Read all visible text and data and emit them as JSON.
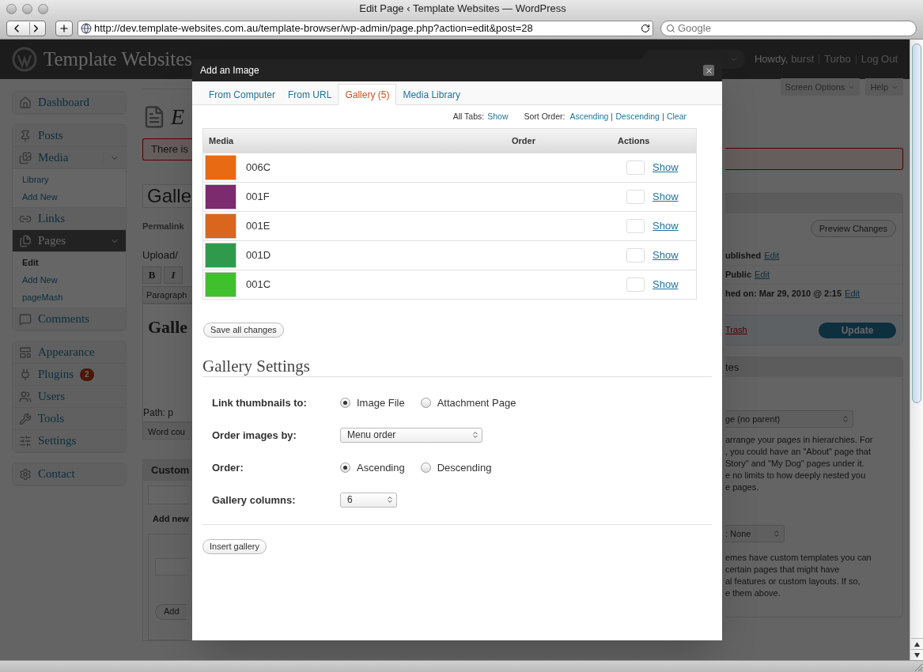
{
  "browser": {
    "title": "Edit Page ‹ Template Websites — WordPress",
    "url": "http://dev.template-websites.com.au/template-browser/wp-admin/page.php?action=edit&post=28",
    "search": {
      "placeholder": "Google"
    }
  },
  "wp_header": {
    "site_title": "Template Websites",
    "greeting": "Howdy,",
    "user": "burst",
    "links": [
      "Turbo",
      "Log Out"
    ]
  },
  "screen_meta": [
    "Screen Options",
    "Help"
  ],
  "sidebar": {
    "groups": [
      [
        {
          "label": "Dashboard",
          "selected": false
        }
      ],
      [
        {
          "label": "Posts",
          "selected": false
        },
        {
          "label": "Media",
          "selected": false,
          "expanded": true,
          "children": [
            {
              "label": "Library",
              "selected": false
            },
            {
              "label": "Add New",
              "selected": false
            }
          ]
        },
        {
          "label": "Links",
          "selected": false
        },
        {
          "label": "Pages",
          "selected": true,
          "expanded": true,
          "children": [
            {
              "label": "Edit",
              "selected": true
            },
            {
              "label": "Add New",
              "selected": false
            },
            {
              "label": "pageMash",
              "selected": false
            }
          ]
        },
        {
          "label": "Comments",
          "selected": false
        }
      ],
      [
        {
          "label": "Appearance",
          "selected": false
        },
        {
          "label": "Plugins",
          "selected": false,
          "badge": "2"
        },
        {
          "label": "Users",
          "selected": false
        },
        {
          "label": "Tools",
          "selected": false
        },
        {
          "label": "Settings",
          "selected": false
        }
      ],
      [
        {
          "label": "Contact",
          "selected": false
        }
      ]
    ]
  },
  "editor_strip": {
    "heading": "E",
    "notice": "There is",
    "title_value": "Galle",
    "permalink": "Permalink",
    "upload_label": "Upload/",
    "toolbar": [
      "B",
      "I"
    ],
    "format_select": "Paragraph",
    "content": "Galle",
    "path": "Path: p",
    "word_count": "Word cou",
    "custom_box": "Custom",
    "add_new": "Add new",
    "add_button": "Add"
  },
  "publish_box": {
    "preview_button": "Preview Changes",
    "rows": [
      {
        "label": "ublished",
        "link": "Edit"
      },
      {
        "label": "Public",
        "link": "Edit"
      },
      {
        "label": "hed on: Mar 29, 2010 @ 2:15",
        "link": "Edit"
      }
    ],
    "trash": "Trash",
    "update_button": "Update"
  },
  "attributes_box": {
    "title": "tes",
    "parent_select": "ge (no parent)",
    "parent_help": [
      "arrange your pages in hierarchies. For",
      ", you could have an \"About\" page that",
      "Story\" and \"My Dog\" pages under it.",
      "e no limits to how deeply nested you",
      "e pages."
    ],
    "template_select": ": None",
    "template_help": [
      "emes have custom templates you can",
      "certain pages that might have",
      "al features or custom layouts. If so,",
      "e them above."
    ]
  },
  "modal": {
    "title": "Add an Image",
    "tabs": [
      {
        "label": "From Computer",
        "selected": false
      },
      {
        "label": "From URL",
        "selected": false
      },
      {
        "label": "Gallery (5)",
        "selected": true
      },
      {
        "label": "Media Library",
        "selected": false
      }
    ],
    "filters": {
      "all_tabs_label": "All Tabs:",
      "all_tabs_link": "Show",
      "sort_label": "Sort Order:",
      "sort_links": [
        "Ascending",
        "Descending",
        "Clear"
      ]
    },
    "table": {
      "columns": [
        "Media",
        "Order",
        "Actions"
      ],
      "rows": [
        {
          "name": "006C",
          "color": "#e86a12",
          "action": "Show"
        },
        {
          "name": "001F",
          "color": "#7b2b6e",
          "action": "Show"
        },
        {
          "name": "001E",
          "color": "#d9661c",
          "action": "Show"
        },
        {
          "name": "001D",
          "color": "#2f9a4c",
          "action": "Show"
        },
        {
          "name": "001C",
          "color": "#3fc02c",
          "action": "Show"
        }
      ]
    },
    "save_button": "Save all changes",
    "settings": {
      "title": "Gallery Settings",
      "fields": [
        {
          "kind": "radio",
          "label": "Link thumbnails to:",
          "options": [
            {
              "label": "Image File",
              "selected": true
            },
            {
              "label": "Attachment Page",
              "selected": false
            }
          ]
        },
        {
          "kind": "select",
          "label": "Order images by:",
          "value": "Menu order"
        },
        {
          "kind": "radio",
          "label": "Order:",
          "options": [
            {
              "label": "Ascending",
              "selected": true
            },
            {
              "label": "Descending",
              "selected": false
            }
          ]
        },
        {
          "kind": "select",
          "label": "Gallery columns:",
          "value": "6"
        }
      ]
    },
    "insert_button": "Insert gallery"
  }
}
